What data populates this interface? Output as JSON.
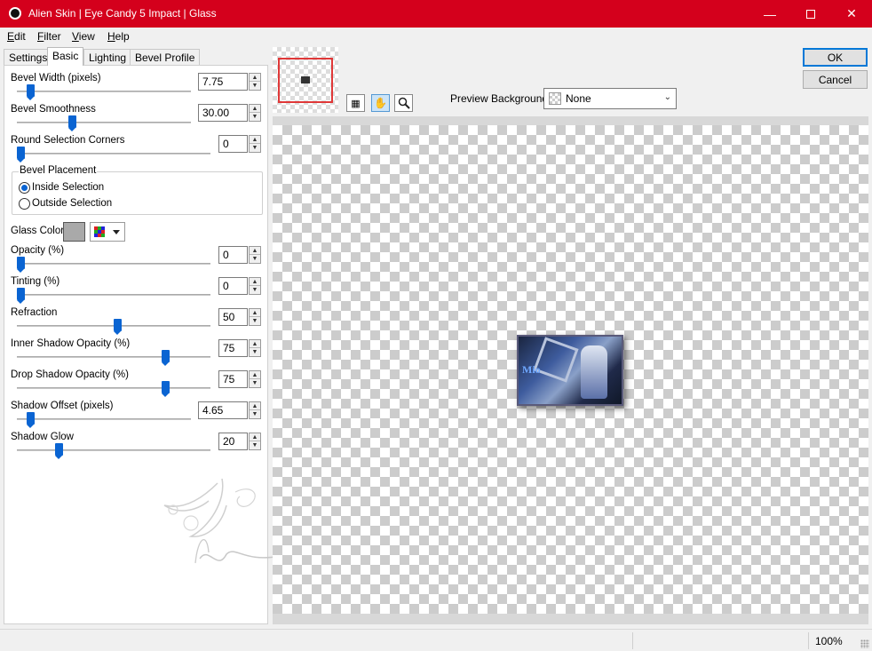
{
  "window": {
    "title": "Alien Skin | Eye Candy 5 Impact | Glass",
    "icon": "alien-skin-icon",
    "accent_color": "#d4001c"
  },
  "menu": {
    "edit": {
      "pre": "",
      "key": "E",
      "rest": "dit"
    },
    "filter": {
      "pre": "",
      "key": "F",
      "rest": "ilter"
    },
    "view": {
      "pre": "",
      "key": "V",
      "rest": "iew"
    },
    "help": {
      "pre": "",
      "key": "H",
      "rest": "elp"
    }
  },
  "tabs": {
    "settings": "Settings",
    "basic": "Basic",
    "lighting": "Lighting",
    "bevel_profile": "Bevel Profile",
    "active": "Basic"
  },
  "controls": {
    "bevel_width": {
      "label": "Bevel Width (pixels)",
      "value": "7.75",
      "level": 0.06
    },
    "bevel_smoothness": {
      "label": "Bevel Smoothness",
      "value": "30.00",
      "level": 0.3
    },
    "round_corners": {
      "label": "Round Selection Corners",
      "value": "0",
      "level": 0.0
    },
    "opacity": {
      "label": "Opacity (%)",
      "value": "0",
      "level": 0.0
    },
    "tinting": {
      "label": "Tinting (%)",
      "value": "0",
      "level": 0.0
    },
    "refraction": {
      "label": "Refraction",
      "value": "50",
      "level": 0.5
    },
    "inner_shadow": {
      "label": "Inner Shadow Opacity (%)",
      "value": "75",
      "level": 0.75
    },
    "drop_shadow": {
      "label": "Drop Shadow Opacity (%)",
      "value": "75",
      "level": 0.75
    },
    "shadow_offset": {
      "label": "Shadow Offset (pixels)",
      "value": "4.65",
      "level": 0.06
    },
    "shadow_glow": {
      "label": "Shadow Glow",
      "value": "20",
      "level": 0.2
    }
  },
  "bevel_placement": {
    "title": "Bevel Placement",
    "inside": "Inside Selection",
    "outside": "Outside Selection",
    "selected": "inside"
  },
  "glass_color": {
    "label": "Glass Color",
    "value": "#a9a9a9"
  },
  "preview_background": {
    "label": "Preview Background:",
    "value": "None"
  },
  "buttons": {
    "ok": "OK",
    "cancel": "Cancel"
  },
  "preview_image": {
    "text": "Mio"
  },
  "status": {
    "zoom": "100%"
  }
}
